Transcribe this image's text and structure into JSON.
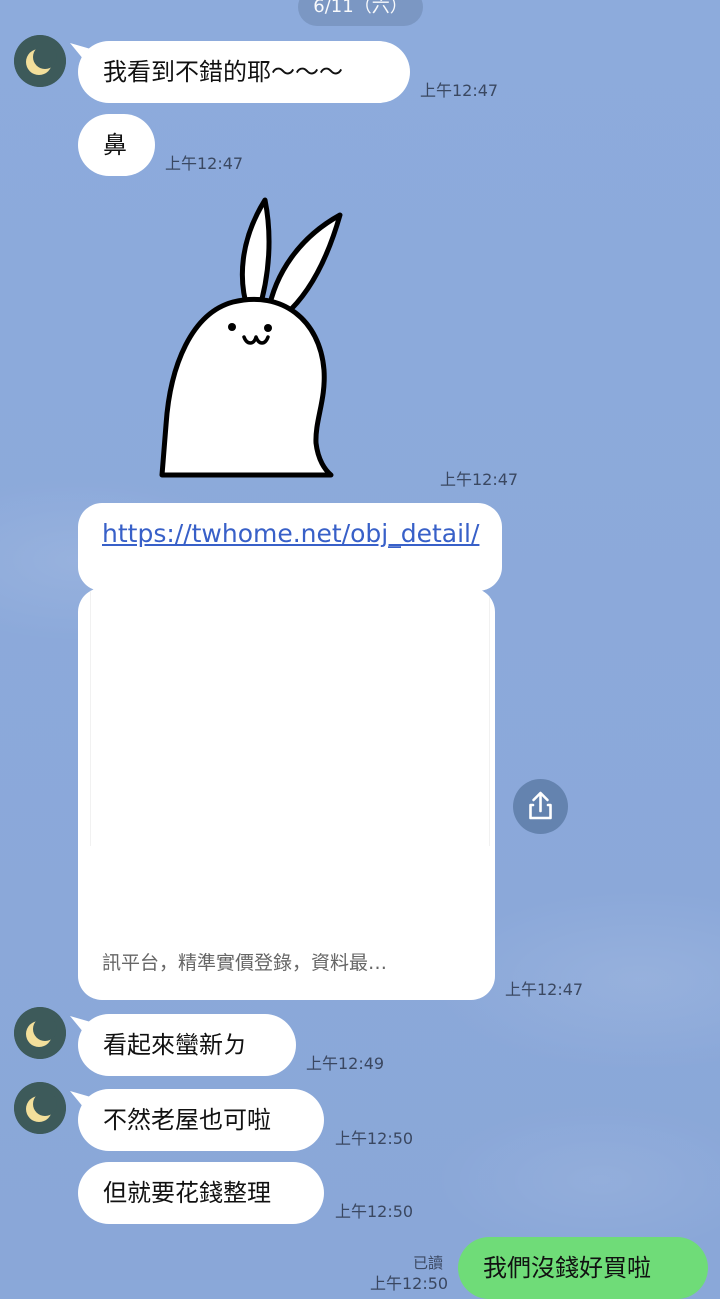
{
  "chat": {
    "date_label": "6/11（六）",
    "messages": [
      {
        "text": "我看到不錯的耶～～～",
        "time": "上午12:47"
      },
      {
        "text": "鼻",
        "time": "上午12:47"
      },
      {
        "sticker": "rabbit-sticker",
        "time": "上午12:47"
      },
      {
        "link_url": "https://twhome.net/obj_detail/",
        "link_description": "訊平台，精準實價登錄，資料最…",
        "time": "上午12:47"
      },
      {
        "text": "看起來蠻新ㄉ",
        "time": "上午12:49"
      },
      {
        "text": "不然老屋也可啦",
        "time": "上午12:50"
      },
      {
        "text": "但就要花錢整理",
        "time": "上午12:50"
      },
      {
        "text": "我們沒錢好買啦",
        "time": "上午12:50",
        "read_label": "已讀",
        "from_me": true
      }
    ]
  },
  "icons": {
    "avatar": "crescent-moon-avatar",
    "share": "share-icon"
  },
  "colors": {
    "background": "#8aa8d9",
    "incoming_bubble": "#ffffff",
    "outgoing_bubble": "#6fdc78",
    "link": "#3860c8",
    "avatar_bg": "#3d5a5a",
    "moon": "#f3df9b"
  }
}
